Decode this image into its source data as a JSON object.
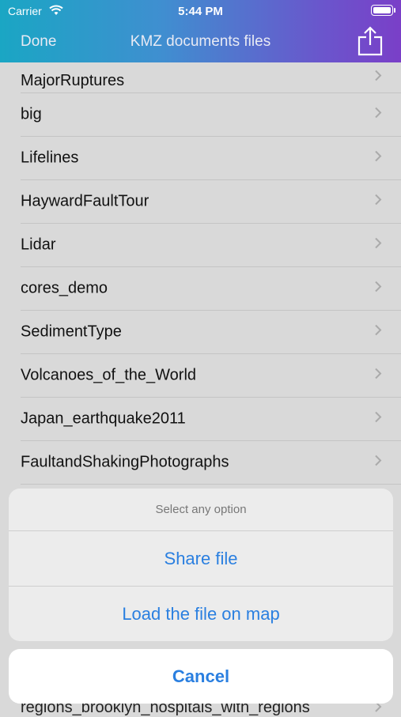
{
  "status_bar": {
    "carrier": "Carrier",
    "time": "5:44 PM"
  },
  "nav": {
    "done_label": "Done",
    "title": "KMZ documents files",
    "share_icon": "share-icon"
  },
  "files": [
    "MajorRuptures",
    "big",
    "Lifelines",
    "HaywardFaultTour",
    "Lidar",
    "cores_demo",
    "SedimentType",
    "Volcanoes_of_the_World",
    "Japan_earthquake2011",
    "FaultandShakingPhotographs"
  ],
  "partial_bottom_file": "regions_brooklyn_hospitals_with_regions",
  "action_sheet": {
    "title": "Select any option",
    "options": [
      "Share file",
      "Load the file on map"
    ],
    "cancel": "Cancel"
  },
  "colors": {
    "accent": "#2a7fe0",
    "header_start": "#1aa6c4",
    "header_end": "#7a3fc8"
  }
}
